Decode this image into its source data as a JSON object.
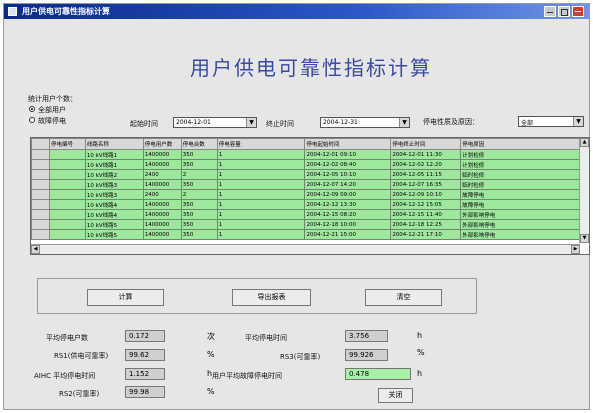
{
  "window": {
    "title": "用户供电可靠性指标计算",
    "colors": {
      "titlebar": "#0a2a8a",
      "row_fill": "#9ee89e",
      "heading": "#3a4aa4",
      "highlight": "#a8f0a8"
    }
  },
  "heading": "用户供电可靠性指标计算",
  "options": {
    "group_label": "统计用户个数：",
    "radio_all": "全部用户",
    "radio_fault": "故障停电"
  },
  "filters": {
    "start_label": "起始时间",
    "start_value": "2004-12-01",
    "end_label": "终止时间",
    "end_value": "2004-12-31",
    "type_label": "停电性质及原因：",
    "type_value": "全部"
  },
  "grid": {
    "headers": [
      "停电编号",
      "线路名称",
      "停电用户数",
      "停电台数",
      "停电容量",
      "停电起始时间",
      "停电终止时间",
      "停电原因"
    ],
    "rows": [
      [
        "",
        "10 kV线路1",
        "1400000",
        "350",
        "1",
        "2004-12-01 09:10",
        "2004-12-01 11:30",
        "计划检修"
      ],
      [
        "",
        "10 kV线路1",
        "1400000",
        "350",
        "1",
        "2004-12-02 08:40",
        "2004-12-02 12:20",
        "计划检修"
      ],
      [
        "",
        "10 kV线路2",
        "2400",
        "2",
        "1",
        "2004-12-05 10:10",
        "2004-12-05 11:15",
        "临时检修"
      ],
      [
        "",
        "10 kV线路3",
        "1400000",
        "350",
        "1",
        "2004-12-07 14:20",
        "2004-12-07 16:35",
        "临时检修"
      ],
      [
        "",
        "10 kV线路3",
        "2400",
        "2",
        "1",
        "2004-12-09 09:00",
        "2004-12-09 10:10",
        "故障停电"
      ],
      [
        "",
        "10 kV线路4",
        "1400000",
        "350",
        "1",
        "2004-12-12 13:30",
        "2004-12-12 15:05",
        "故障停电"
      ],
      [
        "",
        "10 kV线路4",
        "1400000",
        "350",
        "1",
        "2004-12-15 08:20",
        "2004-12-15 11:40",
        "外部影响停电"
      ],
      [
        "",
        "10 kV线路5",
        "1400000",
        "350",
        "1",
        "2004-12-18 10:00",
        "2004-12-18 12:25",
        "外部影响停电"
      ],
      [
        "",
        "10 kV线路5",
        "1400000",
        "350",
        "1",
        "2004-12-21 15:00",
        "2004-12-21 17:10",
        "外部影响停电"
      ]
    ]
  },
  "buttons": {
    "calc": "计算",
    "export": "导出报表",
    "clear": "清空",
    "close": "关闭"
  },
  "results": {
    "saifi_label": "平均停电户数",
    "saifi_value": "0.172",
    "saifi_unit": "次",
    "saidi_label": "平均停电时间",
    "saidi_value": "3.756",
    "saidi_unit": "h",
    "rs1_label": "RS1(供电可靠率)",
    "rs1_value": "99.62",
    "rs1_unit": "%",
    "rs3_label": "RS3(可靠率)",
    "rs3_value": "99.926",
    "rs3_unit": "%",
    "asai_label": "AIHC 平均停电时间",
    "asai_value": "1.152",
    "asai_unit": "h",
    "fault_label": "用户平均故障停电时间",
    "fault_value": "0.478",
    "fault_unit": "h",
    "rs2_label": "RS2(可靠率)",
    "rs2_value": "99.98",
    "rs2_unit": "%"
  }
}
